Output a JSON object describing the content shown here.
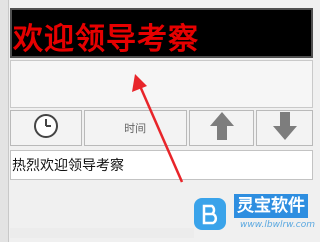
{
  "led_display": {
    "text": "欢迎领导考察",
    "color": "#e60000",
    "background": "#000000"
  },
  "toolbar": {
    "clock_icon": "clock-icon",
    "time_label": "时间",
    "up_icon": "arrow-up-icon",
    "down_icon": "arrow-down-icon"
  },
  "text_input": {
    "value": "热烈欢迎领导考察"
  },
  "annotation": {
    "color": "#e8252a"
  },
  "watermark": {
    "title": "灵宝软件",
    "url": "www.lbwlrw.com",
    "brand_color": "#2e8ee0"
  }
}
